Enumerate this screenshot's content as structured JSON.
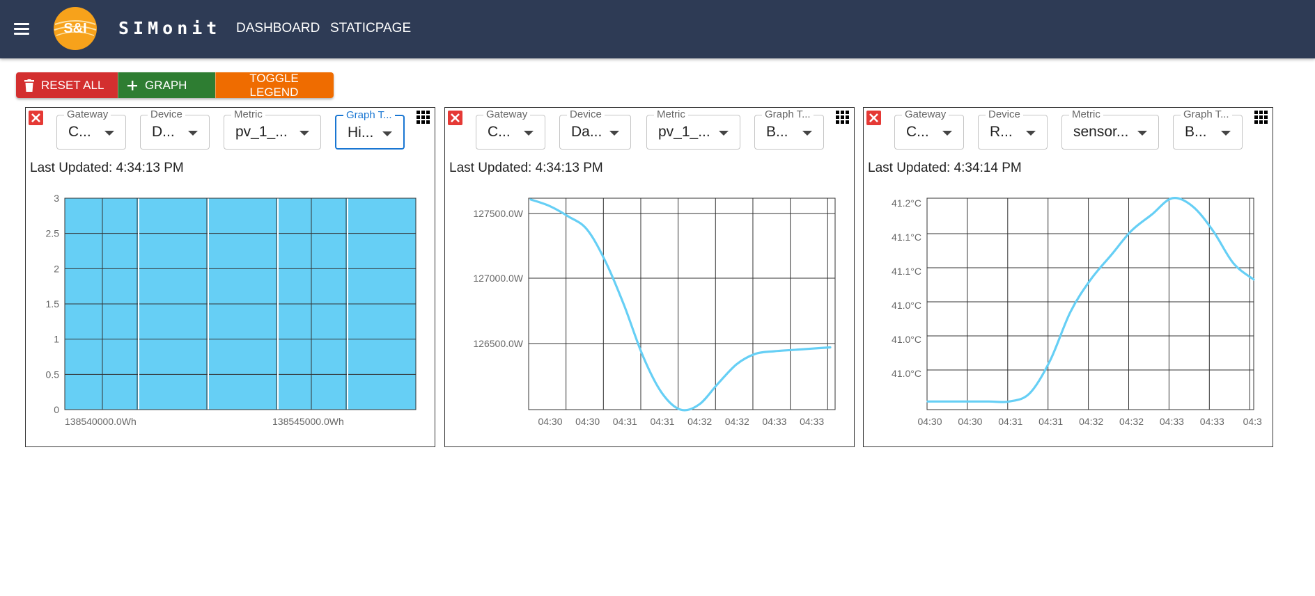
{
  "app": {
    "brand": "SIMonit",
    "logo_text": "S&I",
    "nav": [
      {
        "label": "DASHBOARD"
      },
      {
        "label": "STATICPAGE"
      }
    ]
  },
  "toolbar": {
    "reset_label": "RESET ALL",
    "graph_label": "GRAPH",
    "legend_label": "TOGGLE LEGEND"
  },
  "colors": {
    "appbar": "#2e3b55",
    "reset": "#d32f2f",
    "graph": "#2e7d32",
    "legend": "#ef6c00",
    "series": "#66cff5"
  },
  "cards": [
    {
      "fields": [
        {
          "label": "Gateway",
          "value": "C..."
        },
        {
          "label": "Device",
          "value": "D..."
        },
        {
          "label": "Metric",
          "value": "pv_1_..."
        },
        {
          "label": "Graph T...",
          "value": "Hi..."
        }
      ],
      "last_updated": "Last Updated: 4:34:13 PM",
      "chart_data": {
        "type": "bar",
        "ylim": [
          0,
          3
        ],
        "yticks": [
          "3",
          "2.5",
          "2",
          "1.5",
          "1",
          "0.5",
          "0"
        ],
        "xticks": [
          "138540000.0Wh",
          "138545000.0Wh"
        ],
        "bins": [
          3,
          3,
          3,
          3,
          3,
          3,
          3,
          3,
          3
        ]
      }
    },
    {
      "fields": [
        {
          "label": "Gateway",
          "value": "C..."
        },
        {
          "label": "Device",
          "value": "Da..."
        },
        {
          "label": "Metric",
          "value": "pv_1_..."
        },
        {
          "label": "Graph T...",
          "value": "B..."
        }
      ],
      "last_updated": "Last Updated: 4:34:13 PM",
      "chart_data": {
        "type": "line",
        "yticks": [
          "127500.0W",
          "127000.0W",
          "126500.0W"
        ],
        "xticks": [
          "04:30",
          "04:30",
          "04:31",
          "04:31",
          "04:32",
          "04:32",
          "04:33",
          "04:33"
        ],
        "ylim": [
          125990,
          127620
        ],
        "y": [
          127610,
          127560,
          127480,
          127380,
          127130,
          126790,
          126400,
          126120,
          125990,
          126030,
          126190,
          126340,
          126420,
          126440,
          126450,
          126460,
          126470
        ]
      }
    },
    {
      "fields": [
        {
          "label": "Gateway",
          "value": "C..."
        },
        {
          "label": "Device",
          "value": "R..."
        },
        {
          "label": "Metric",
          "value": "sensor..."
        },
        {
          "label": "Graph T...",
          "value": "B..."
        }
      ],
      "last_updated": "Last Updated: 4:34:14 PM",
      "chart_data": {
        "type": "line",
        "yticks": [
          "41.2°C",
          "41.1°C",
          "41.1°C",
          "41.0°C",
          "41.0°C",
          "41.0°C"
        ],
        "xticks": [
          "04:30",
          "04:30",
          "04:31",
          "04:31",
          "04:32",
          "04:32",
          "04:33",
          "04:33",
          "04:3"
        ],
        "ylim": [
          40.94,
          41.2
        ],
        "y": [
          40.95,
          40.95,
          40.95,
          40.95,
          40.95,
          40.96,
          41.0,
          41.06,
          41.1,
          41.13,
          41.16,
          41.18,
          41.2,
          41.19,
          41.16,
          41.12,
          41.1
        ]
      }
    }
  ]
}
